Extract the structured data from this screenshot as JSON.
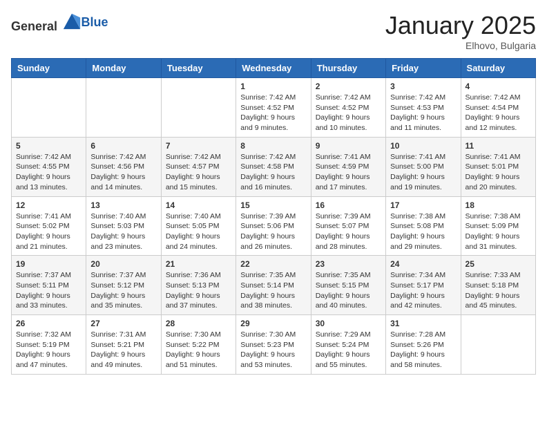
{
  "header": {
    "logo_general": "General",
    "logo_blue": "Blue",
    "month": "January 2025",
    "location": "Elhovo, Bulgaria"
  },
  "weekdays": [
    "Sunday",
    "Monday",
    "Tuesday",
    "Wednesday",
    "Thursday",
    "Friday",
    "Saturday"
  ],
  "weeks": [
    [
      {
        "day": "",
        "info": ""
      },
      {
        "day": "",
        "info": ""
      },
      {
        "day": "",
        "info": ""
      },
      {
        "day": "1",
        "info": "Sunrise: 7:42 AM\nSunset: 4:52 PM\nDaylight: 9 hours\nand 9 minutes."
      },
      {
        "day": "2",
        "info": "Sunrise: 7:42 AM\nSunset: 4:52 PM\nDaylight: 9 hours\nand 10 minutes."
      },
      {
        "day": "3",
        "info": "Sunrise: 7:42 AM\nSunset: 4:53 PM\nDaylight: 9 hours\nand 11 minutes."
      },
      {
        "day": "4",
        "info": "Sunrise: 7:42 AM\nSunset: 4:54 PM\nDaylight: 9 hours\nand 12 minutes."
      }
    ],
    [
      {
        "day": "5",
        "info": "Sunrise: 7:42 AM\nSunset: 4:55 PM\nDaylight: 9 hours\nand 13 minutes."
      },
      {
        "day": "6",
        "info": "Sunrise: 7:42 AM\nSunset: 4:56 PM\nDaylight: 9 hours\nand 14 minutes."
      },
      {
        "day": "7",
        "info": "Sunrise: 7:42 AM\nSunset: 4:57 PM\nDaylight: 9 hours\nand 15 minutes."
      },
      {
        "day": "8",
        "info": "Sunrise: 7:42 AM\nSunset: 4:58 PM\nDaylight: 9 hours\nand 16 minutes."
      },
      {
        "day": "9",
        "info": "Sunrise: 7:41 AM\nSunset: 4:59 PM\nDaylight: 9 hours\nand 17 minutes."
      },
      {
        "day": "10",
        "info": "Sunrise: 7:41 AM\nSunset: 5:00 PM\nDaylight: 9 hours\nand 19 minutes."
      },
      {
        "day": "11",
        "info": "Sunrise: 7:41 AM\nSunset: 5:01 PM\nDaylight: 9 hours\nand 20 minutes."
      }
    ],
    [
      {
        "day": "12",
        "info": "Sunrise: 7:41 AM\nSunset: 5:02 PM\nDaylight: 9 hours\nand 21 minutes."
      },
      {
        "day": "13",
        "info": "Sunrise: 7:40 AM\nSunset: 5:03 PM\nDaylight: 9 hours\nand 23 minutes."
      },
      {
        "day": "14",
        "info": "Sunrise: 7:40 AM\nSunset: 5:05 PM\nDaylight: 9 hours\nand 24 minutes."
      },
      {
        "day": "15",
        "info": "Sunrise: 7:39 AM\nSunset: 5:06 PM\nDaylight: 9 hours\nand 26 minutes."
      },
      {
        "day": "16",
        "info": "Sunrise: 7:39 AM\nSunset: 5:07 PM\nDaylight: 9 hours\nand 28 minutes."
      },
      {
        "day": "17",
        "info": "Sunrise: 7:38 AM\nSunset: 5:08 PM\nDaylight: 9 hours\nand 29 minutes."
      },
      {
        "day": "18",
        "info": "Sunrise: 7:38 AM\nSunset: 5:09 PM\nDaylight: 9 hours\nand 31 minutes."
      }
    ],
    [
      {
        "day": "19",
        "info": "Sunrise: 7:37 AM\nSunset: 5:11 PM\nDaylight: 9 hours\nand 33 minutes."
      },
      {
        "day": "20",
        "info": "Sunrise: 7:37 AM\nSunset: 5:12 PM\nDaylight: 9 hours\nand 35 minutes."
      },
      {
        "day": "21",
        "info": "Sunrise: 7:36 AM\nSunset: 5:13 PM\nDaylight: 9 hours\nand 37 minutes."
      },
      {
        "day": "22",
        "info": "Sunrise: 7:35 AM\nSunset: 5:14 PM\nDaylight: 9 hours\nand 38 minutes."
      },
      {
        "day": "23",
        "info": "Sunrise: 7:35 AM\nSunset: 5:15 PM\nDaylight: 9 hours\nand 40 minutes."
      },
      {
        "day": "24",
        "info": "Sunrise: 7:34 AM\nSunset: 5:17 PM\nDaylight: 9 hours\nand 42 minutes."
      },
      {
        "day": "25",
        "info": "Sunrise: 7:33 AM\nSunset: 5:18 PM\nDaylight: 9 hours\nand 45 minutes."
      }
    ],
    [
      {
        "day": "26",
        "info": "Sunrise: 7:32 AM\nSunset: 5:19 PM\nDaylight: 9 hours\nand 47 minutes."
      },
      {
        "day": "27",
        "info": "Sunrise: 7:31 AM\nSunset: 5:21 PM\nDaylight: 9 hours\nand 49 minutes."
      },
      {
        "day": "28",
        "info": "Sunrise: 7:30 AM\nSunset: 5:22 PM\nDaylight: 9 hours\nand 51 minutes."
      },
      {
        "day": "29",
        "info": "Sunrise: 7:30 AM\nSunset: 5:23 PM\nDaylight: 9 hours\nand 53 minutes."
      },
      {
        "day": "30",
        "info": "Sunrise: 7:29 AM\nSunset: 5:24 PM\nDaylight: 9 hours\nand 55 minutes."
      },
      {
        "day": "31",
        "info": "Sunrise: 7:28 AM\nSunset: 5:26 PM\nDaylight: 9 hours\nand 58 minutes."
      },
      {
        "day": "",
        "info": ""
      }
    ]
  ]
}
